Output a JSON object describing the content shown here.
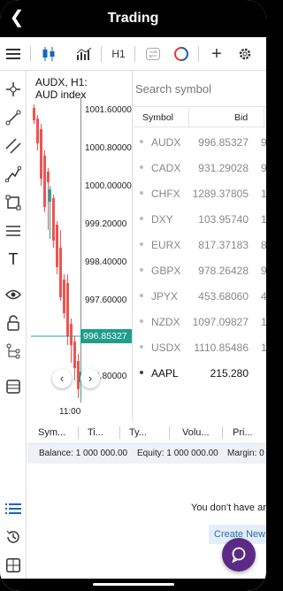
{
  "app": {
    "title": "Trading"
  },
  "toolbar": {
    "timeframe": "H1"
  },
  "chart": {
    "header_line1": "AUDX, H1:",
    "header_line2": "AUD index",
    "price_labels": [
      "1001.60000",
      "1000.80000",
      "1000.00000",
      "999.20000",
      "998.40000",
      "997.60000",
      "996.80000"
    ],
    "current_price": "996.85327",
    "time_label": "11:00",
    "up_color": "#26a69a",
    "down_color": "#ef5350"
  },
  "watchlist": {
    "search_placeholder": "Search symbol",
    "columns": {
      "symbol": "Symbol",
      "bid": "Bid"
    },
    "rows": [
      {
        "symbol": "AUDX",
        "bid": "996.85327",
        "ask": "9"
      },
      {
        "symbol": "CADX",
        "bid": "931.29028",
        "ask": "9"
      },
      {
        "symbol": "CHFX",
        "bid": "1289.37805",
        "ask": "12"
      },
      {
        "symbol": "DXY",
        "bid": "103.95740",
        "ask": "1"
      },
      {
        "symbol": "EURX",
        "bid": "817.37183",
        "ask": "8"
      },
      {
        "symbol": "GBPX",
        "bid": "978.26428",
        "ask": "9"
      },
      {
        "symbol": "JPYX",
        "bid": "453.68060",
        "ask": "4"
      },
      {
        "symbol": "NZDX",
        "bid": "1097.09827",
        "ask": "10"
      },
      {
        "symbol": "USDX",
        "bid": "1110.85486",
        "ask": "11"
      },
      {
        "symbol": "AAPL",
        "bid": "215.280",
        "ask": ""
      }
    ]
  },
  "orders": {
    "columns": [
      "Sym...",
      "Ti...",
      "Ty...",
      "Volu...",
      "Pri..."
    ],
    "balance": "Balance: 1 000 000.00",
    "equity": "Equity: 1 000 000.00",
    "margin": "Margin: 0",
    "empty_text": "You don't have ar",
    "create_label": "Create New"
  },
  "brand_color": "#5b2a86"
}
